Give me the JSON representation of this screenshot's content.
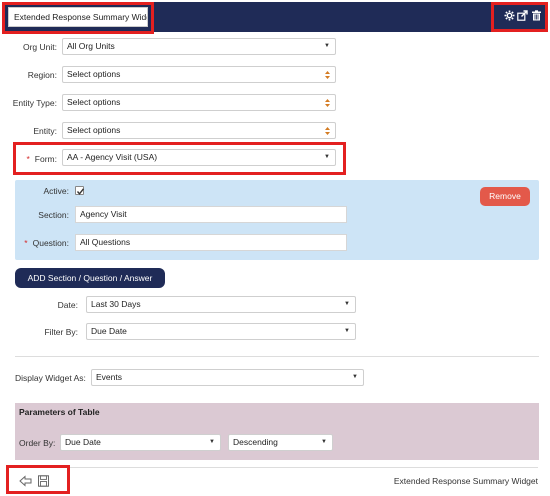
{
  "header": {
    "title_value": "Extended Response Summary Widget",
    "icons": [
      "gear-icon",
      "expand-icon",
      "trash-icon"
    ],
    "bg_color": "#1f2b57"
  },
  "filters": {
    "org_unit": {
      "label": "Org Unit:",
      "value": "All Org Units"
    },
    "region": {
      "label": "Region:",
      "value": "Select options"
    },
    "entity_type": {
      "label": "Entity Type:",
      "value": "Select options"
    },
    "entity": {
      "label": "Entity:",
      "value": "Select options"
    },
    "form": {
      "required_mark": "*",
      "label": "Form:",
      "value": "AA - Agency Visit (USA)"
    }
  },
  "question_block": {
    "active_label": "Active:",
    "active_checked": true,
    "section_label": "Section:",
    "section_value": "Agency Visit",
    "question_required_mark": "*",
    "question_label": "Question:",
    "question_value": "All Questions",
    "remove_label": "Remove"
  },
  "add_button_label": "ADD Section / Question / Answer",
  "date": {
    "label": "Date:",
    "value": "Last 30 Days"
  },
  "filter_by": {
    "label": "Filter By:",
    "value": "Due Date"
  },
  "display_widget": {
    "label": "Display Widget As:",
    "value": "Events"
  },
  "params": {
    "title": "Parameters of Table",
    "order_by_label": "Order By:",
    "order_by_value": "Due Date",
    "direction_value": "Descending"
  },
  "footer": {
    "widget_name": "Extended Response Summary Widget",
    "icons": [
      "back-arrow-icon",
      "save-icon"
    ]
  },
  "colors": {
    "navy": "#1f2b57",
    "highlight_red": "#e32020",
    "remove_red": "#e3594a",
    "panel_blue": "#cde4f6",
    "panel_mauve": "#dbc9d3"
  }
}
